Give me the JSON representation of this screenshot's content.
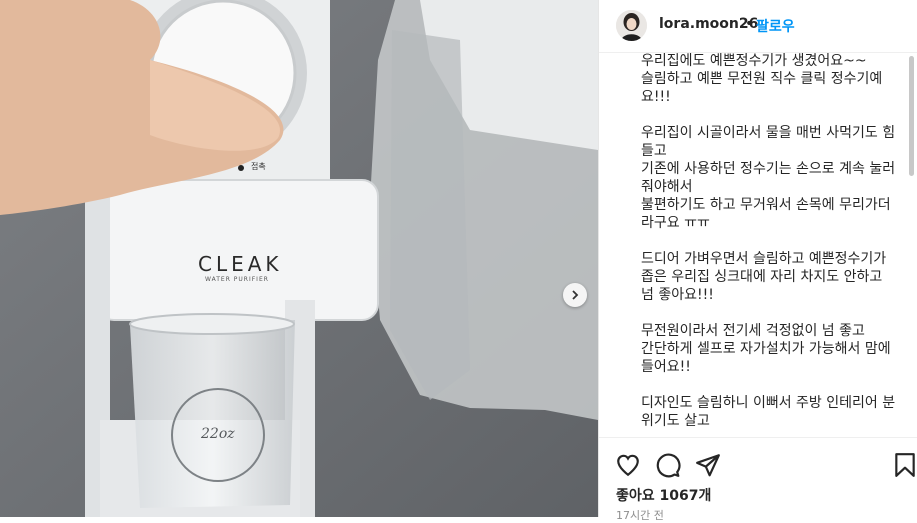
{
  "post": {
    "username": "lora.moon26",
    "separator": "•",
    "follow_label": "팔로우",
    "caption_paragraphs": [
      "우리집에도 예쁜정수기가 생겼어요~~\n슬림하고 예쁜 무전원 직수 클릭 정수기예요!!!",
      "우리집이 시골이라서 물을 매번 사먹기도 힘들고\n기존에 사용하던 정수기는 손으로 계속 눌러줘야해서\n불편하기도 하고 무거워서 손목에 무리가더라구요 ㅠㅠ",
      "드디어 가벼우면서 슬림하고 예쁜정수기가\n좁은 우리집 싱크대에 자리 차지도 안하고 넘 좋아요!!!",
      "무전원이라서 전기세 걱정없이 넘 좋고\n간단하게 셀프로 자가설치가 가능해서 맘에 들어요!!",
      "디자인도 슬림하니 이뻐서 주방 인테리어 분위기도 살고"
    ],
    "likes_text": "좋아요 1067개",
    "time_text": "17시간 전"
  },
  "media": {
    "brand_text": "CLEAK",
    "brand_sub_text": "WATER PURIFIER",
    "button_label": "접촉",
    "glass_text": "22oz"
  },
  "icons": {
    "like": "heart-icon",
    "comment": "comment-icon",
    "share": "share-icon",
    "save": "bookmark-icon",
    "next": "chevron-right-icon"
  },
  "colors": {
    "follow": "#0095f6",
    "text": "#262626",
    "muted": "#8e8e8e"
  }
}
